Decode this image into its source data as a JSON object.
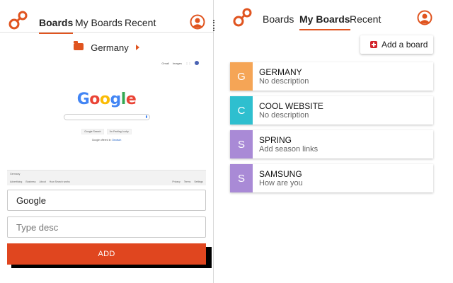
{
  "left_panel": {
    "nav": {
      "tabs": [
        {
          "label": "Boards",
          "active": true
        },
        {
          "label": "My Boards",
          "active": false
        },
        {
          "label": "Recent",
          "active": false
        }
      ]
    },
    "folder": {
      "name": "Germany",
      "icon": "folder-icon"
    },
    "page_preview": {
      "top_links": [
        "Gmail",
        "Images"
      ],
      "logo_text": "Google",
      "buttons": [
        "Google Search",
        "I'm Feeling Lucky"
      ],
      "offered_in_prefix": "Google offered in:",
      "offered_in_language": "Deutsch",
      "footer_country": "Germany",
      "footer_left_links": [
        "Advertising",
        "Business",
        "About",
        "How Search works"
      ],
      "footer_right_links": [
        "Privacy",
        "Terms",
        "Settings"
      ]
    },
    "title_field": {
      "value": "Google"
    },
    "desc_field": {
      "placeholder": "Type desc"
    },
    "add_button_label": "ADD"
  },
  "right_panel": {
    "nav": {
      "tabs": [
        {
          "label": "Boards",
          "active": false
        },
        {
          "label": "My Boards",
          "active": true
        },
        {
          "label": "Recent",
          "active": false
        }
      ]
    },
    "add_board_label": "Add a board",
    "boards": [
      {
        "letter": "G",
        "name": "GERMANY",
        "description": "No description",
        "color": "#f5a556"
      },
      {
        "letter": "C",
        "name": "COOL WEBSITE",
        "description": "No description",
        "color": "#2ebfcf"
      },
      {
        "letter": "S",
        "name": "SPRING",
        "description": "Add season links",
        "color": "#a98ad6"
      },
      {
        "letter": "S",
        "name": "SAMSUNG",
        "description": "How are you",
        "color": "#a98ad6"
      }
    ]
  },
  "colors": {
    "accent": "#e0541f",
    "add_button": "#e0461f",
    "plus_icon": "#d3232a"
  }
}
